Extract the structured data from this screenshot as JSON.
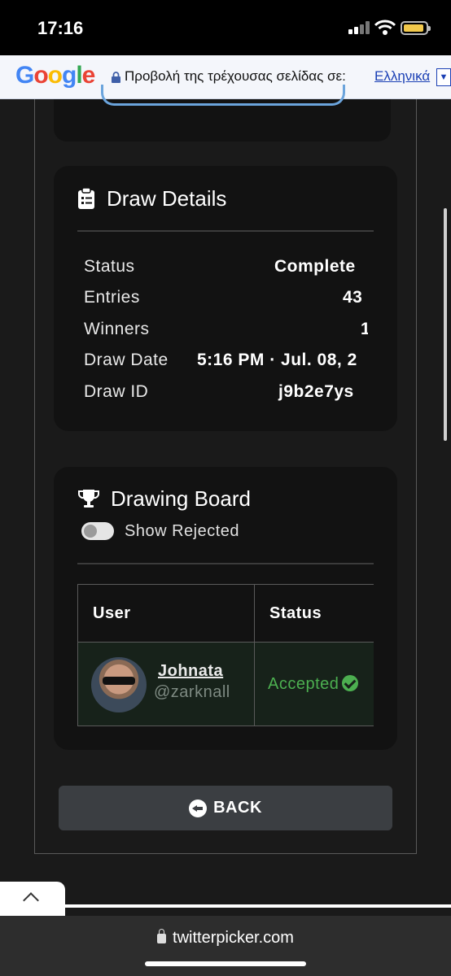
{
  "status_bar": {
    "time": "17:16"
  },
  "translate_bar": {
    "logo": [
      "G",
      "o",
      "o",
      "g",
      "l",
      "e"
    ],
    "prompt": "Προβολή της τρέχουσας σελίδας σε:",
    "language": "Ελληνικά",
    "dropdown_glyph": "▼"
  },
  "draw_details": {
    "title": "Draw Details",
    "rows": [
      {
        "label": "Status",
        "value": "Complete"
      },
      {
        "label": "Entries",
        "value": "43"
      },
      {
        "label": "Winners",
        "value": "1"
      },
      {
        "label": "Draw Date",
        "value": "5:16 PM · Jul. 08, 2"
      },
      {
        "label": "Draw ID",
        "value": "j9b2e7ys"
      }
    ]
  },
  "drawing_board": {
    "title": "Drawing Board",
    "toggle_label": "Show Rejected",
    "columns": [
      "User",
      "Status"
    ],
    "rows": [
      {
        "name": "Johnata",
        "handle": "@zarknall",
        "status": "Accepted"
      }
    ]
  },
  "back_button": {
    "label": "BACK"
  },
  "browser": {
    "url": "twitterpicker.com"
  }
}
